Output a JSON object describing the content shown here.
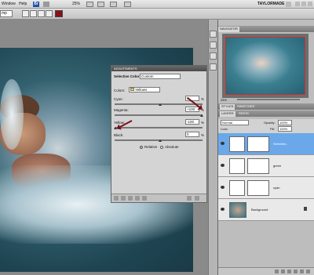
{
  "menubar": {
    "items": [
      "Window",
      "Help"
    ],
    "zoom": "25%",
    "workspace": "TAYLORMADE"
  },
  "options": {
    "preset": "mp"
  },
  "adjustments": {
    "title": "ADJUSTMENTS",
    "panel_label": "Selective Color",
    "preset": "Custom",
    "colors_label": "Colors:",
    "colors_value": "Yellows",
    "cyan_label": "Cyan:",
    "cyan_value": "0",
    "magenta_label": "Magenta:",
    "magenta_value": "+100",
    "yellow_label": "Yellow:",
    "yellow_value": "-100",
    "black_label": "Black:",
    "black_value": "0",
    "unit": "%",
    "relative_label": "Relative",
    "absolute_label": "Absolute"
  },
  "navigator": {
    "title": "NAVIGATOR",
    "zoom": "25%"
  },
  "styles_tabs": {
    "styles": "STYLES",
    "swatches": "SWATCHES"
  },
  "layers": {
    "tab_layers": "LAYERS",
    "tab_paths": "PATHS",
    "blend_mode": "Normal",
    "opacity_label": "Opacity:",
    "opacity_value": "100%",
    "lock_label": "Lock:",
    "fill_label": "Fill:",
    "fill_value": "100%",
    "items": [
      {
        "name": "Selective..."
      },
      {
        "name": "green"
      },
      {
        "name": "cyan"
      },
      {
        "name": "Background"
      }
    ]
  },
  "colors": {
    "accent_red": "#7a0f1a",
    "selection_blue": "#6aa8ea",
    "foreground_swatch": "#8b0f18"
  }
}
